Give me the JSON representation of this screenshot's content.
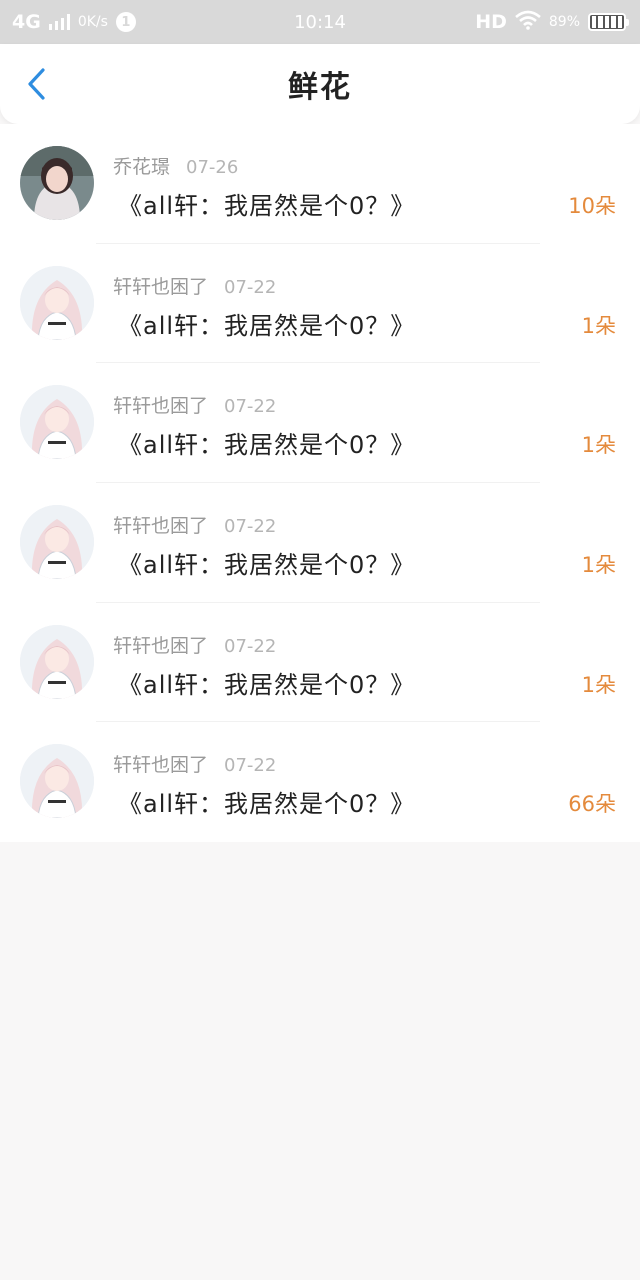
{
  "status_bar": {
    "network": "4G",
    "speed": "0K/s",
    "notification_count": "1",
    "time": "10:14",
    "hd": "HD",
    "battery": "89%"
  },
  "header": {
    "title": "鲜花",
    "accent_color": "#2e8de0"
  },
  "list": {
    "count_color": "#e48a3c",
    "items": [
      {
        "username": "乔花璟",
        "date": "07-26",
        "message": "《all轩：我居然是个0？》",
        "count": "10朵",
        "avatar": "photo-avatar"
      },
      {
        "username": "轩轩也困了",
        "date": "07-22",
        "message": "《all轩：我居然是个0？》",
        "count": "1朵",
        "avatar": "anime-avatar"
      },
      {
        "username": "轩轩也困了",
        "date": "07-22",
        "message": "《all轩：我居然是个0？》",
        "count": "1朵",
        "avatar": "anime-avatar"
      },
      {
        "username": "轩轩也困了",
        "date": "07-22",
        "message": "《all轩：我居然是个0？》",
        "count": "1朵",
        "avatar": "anime-avatar"
      },
      {
        "username": "轩轩也困了",
        "date": "07-22",
        "message": "《all轩：我居然是个0？》",
        "count": "1朵",
        "avatar": "anime-avatar"
      },
      {
        "username": "轩轩也困了",
        "date": "07-22",
        "message": "《all轩：我居然是个0？》",
        "count": "66朵",
        "avatar": "anime-avatar"
      }
    ]
  }
}
